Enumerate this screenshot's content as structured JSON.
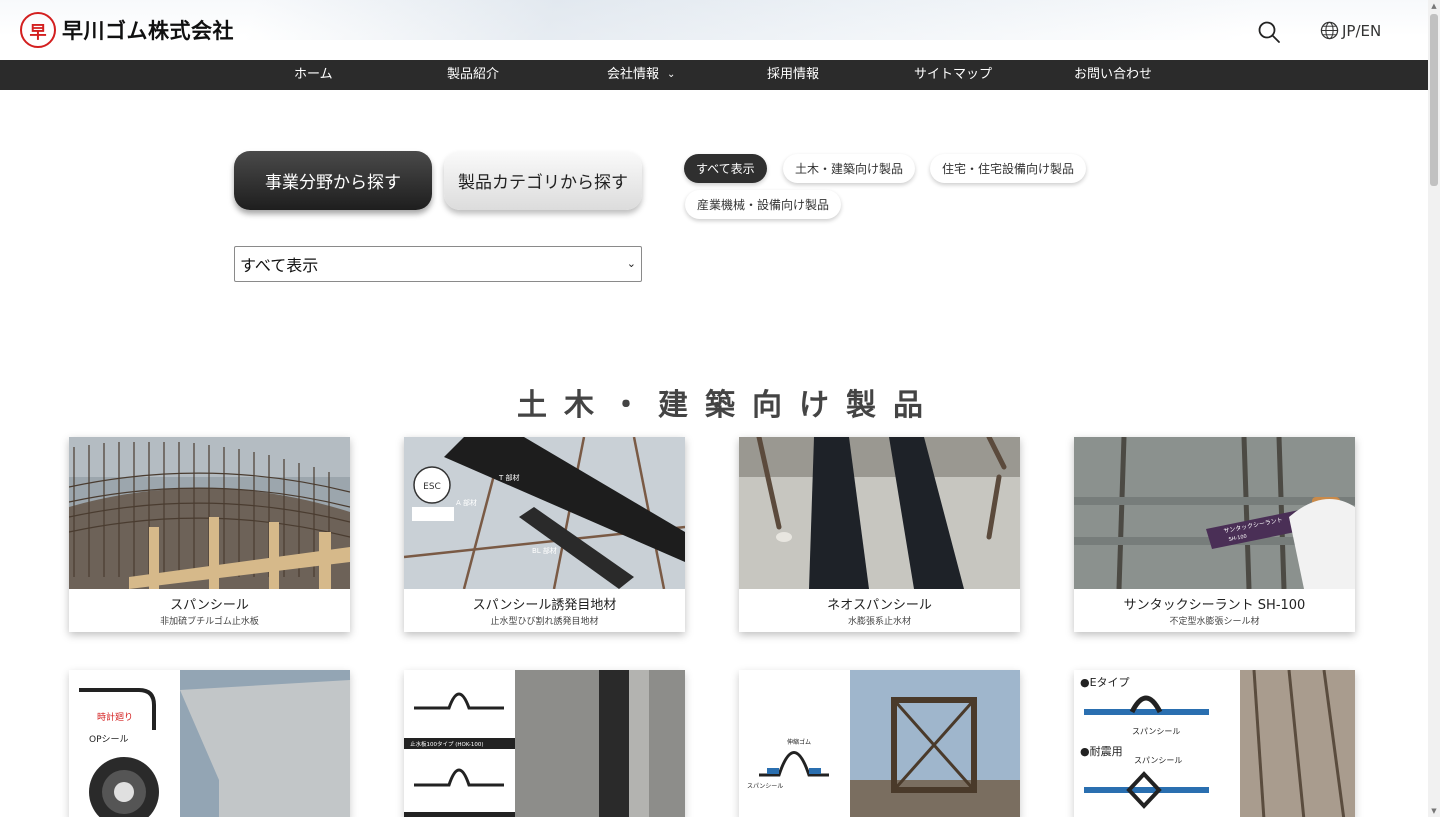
{
  "header": {
    "logo_mark": "早",
    "logo_text": "早川ゴム株式会社",
    "lang_label": "JP/EN"
  },
  "nav": {
    "items": [
      {
        "label": "ホーム"
      },
      {
        "label": "製品紹介"
      },
      {
        "label": "会社情報",
        "has_dropdown": true
      },
      {
        "label": "採用情報"
      },
      {
        "label": "サイトマップ"
      },
      {
        "label": "お問い合わせ"
      }
    ]
  },
  "filters": {
    "tab_business": "事業分野から探す",
    "tab_category": "製品カテゴリから探す",
    "pills": [
      "すべて表示",
      "土木・建築向け製品",
      "住宅・住宅設備向け製品",
      "産業機械・設備向け製品"
    ],
    "active_pill": "すべて表示",
    "select_value": "すべて表示"
  },
  "section": {
    "title": "土木・建築向け製品"
  },
  "products": [
    {
      "name": "スパンシール",
      "sub": "非加硫ブチルゴム止水板"
    },
    {
      "name": "スパンシール誘発目地材",
      "sub": "止水型ひび割れ誘発目地材"
    },
    {
      "name": "ネオスパンシール",
      "sub": "水膨張系止水材"
    },
    {
      "name": "サンタックシーラント SH-100",
      "sub": "不定型水膨張シール材"
    }
  ],
  "image_labels": {
    "card2_t": "T 部材",
    "card2_a": "A 部材",
    "card2_bl": "BL 部材",
    "card4_tube": "サンタックシーラント",
    "card4_tube_code": "SH-100",
    "row2_card1_a": "時計廻り",
    "row2_card1_b": "OPシール",
    "row2_card2_a": "止水板100タイプ (HOK-100)",
    "row2_card3_a": "伸縮ゴム",
    "row2_card3_b": "スパンシール",
    "row2_card4_a": "●Eタイプ",
    "row2_card4_b": "スパンシール",
    "row2_card4_c": "●耐震用",
    "row2_card4_d": "スパンシール"
  },
  "colors": {
    "nav_bg": "#2b2b2b",
    "logo_red": "#d31f1f",
    "active_pill_bg": "#2f2f2f"
  }
}
